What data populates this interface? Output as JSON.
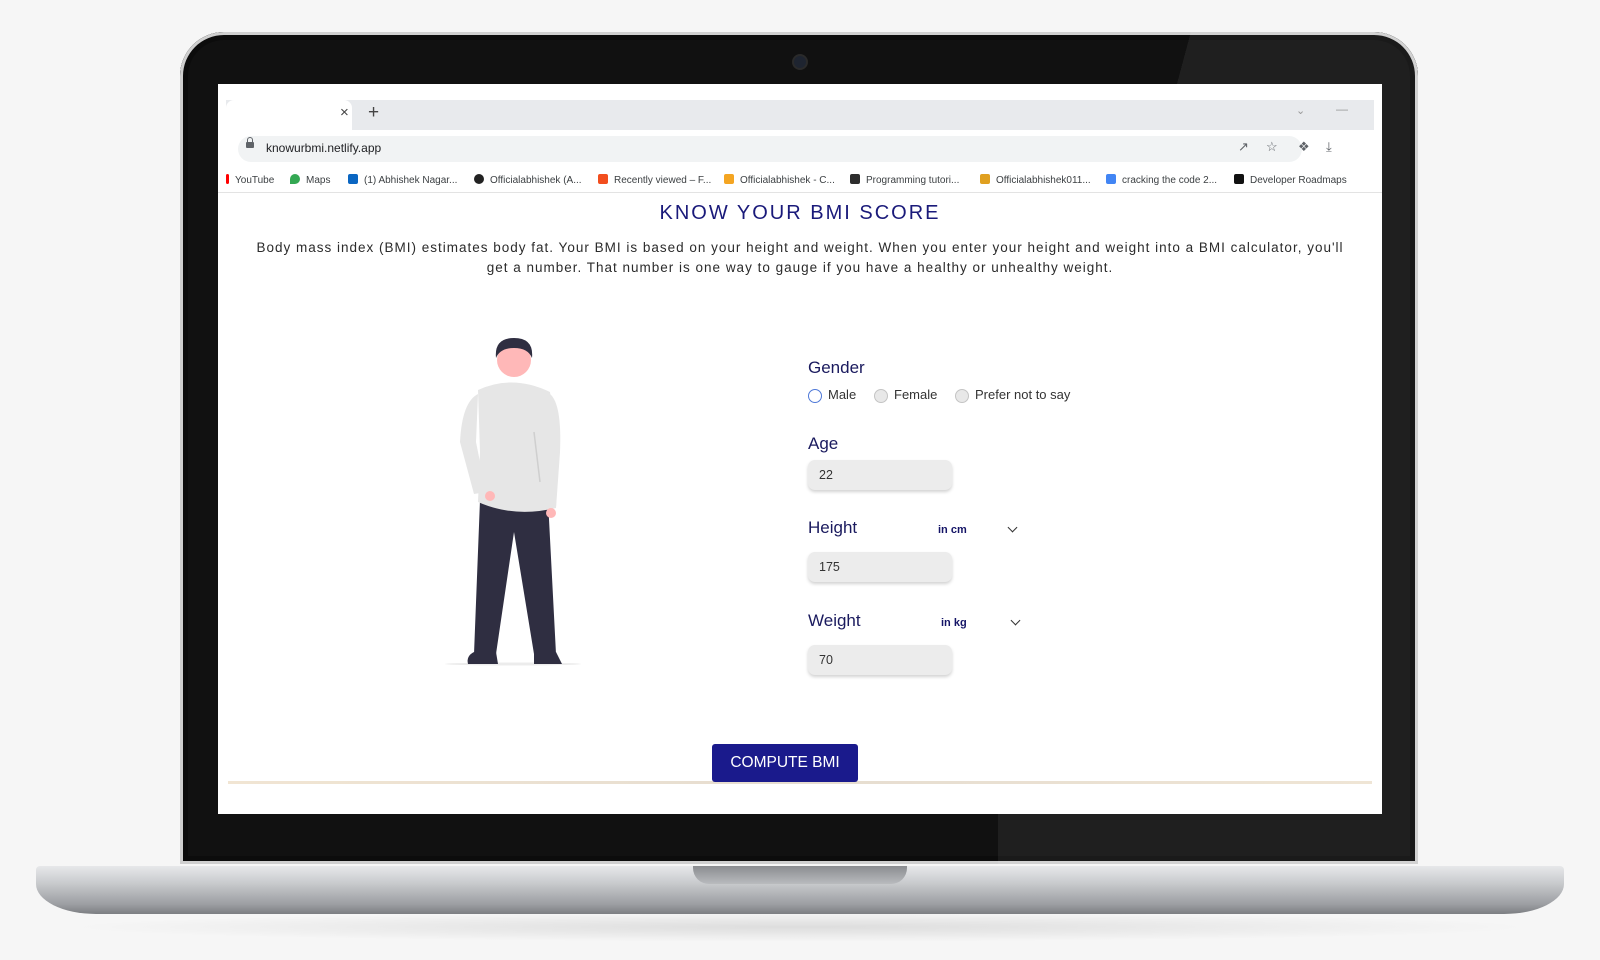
{
  "browser": {
    "url": "knowurbmi.netlify.app",
    "tab_close_glyph": "×",
    "new_tab_glyph": "+"
  },
  "bookmarks": [
    {
      "label": "YouTube",
      "icon": "youtube-icon",
      "color": "#ff0000"
    },
    {
      "label": "Maps",
      "icon": "maps-icon",
      "color": "#34a853"
    },
    {
      "label": "(1) Abhishek Nagar...",
      "icon": "linkedin-icon",
      "color": "#0a66c2"
    },
    {
      "label": "Officialabhishek (A...",
      "icon": "github-icon",
      "color": "#222222"
    },
    {
      "label": "Recently viewed – F...",
      "icon": "figma-icon",
      "color": "#f24e1e"
    },
    {
      "label": "Officialabhishek - C...",
      "icon": "chart-icon",
      "color": "#f4a522"
    },
    {
      "label": "Programming tutori...",
      "icon": "hashnode-icon",
      "color": "#2d2d2d"
    },
    {
      "label": "Officialabhishek011...",
      "icon": "leetcode-icon",
      "color": "#e0a020"
    },
    {
      "label": "cracking the code 2...",
      "icon": "docs-icon",
      "color": "#4285f4"
    },
    {
      "label": "Developer Roadmaps",
      "icon": "roadmap-icon",
      "color": "#111111"
    }
  ],
  "page": {
    "title": "KNOW YOUR BMI SCORE",
    "description": "Body mass index (BMI) estimates body fat. Your BMI is based on your height and weight. When you enter your height and weight into a BMI calculator, you'll get a number. That number is one way to gauge if you have a healthy or unhealthy weight."
  },
  "form": {
    "gender": {
      "label": "Gender",
      "options": [
        "Male",
        "Female",
        "Prefer not to say"
      ],
      "selected": "Male"
    },
    "age": {
      "label": "Age",
      "value": "22"
    },
    "height": {
      "label": "Height",
      "unit": "in cm",
      "value": "175"
    },
    "weight": {
      "label": "Weight",
      "unit": "in kg",
      "value": "70"
    },
    "submit_label": "COMPUTE BMI"
  },
  "colors": {
    "accent": "#1a1a8c",
    "heading": "#1a1a7a",
    "radio_selected": "#4f79d8"
  }
}
